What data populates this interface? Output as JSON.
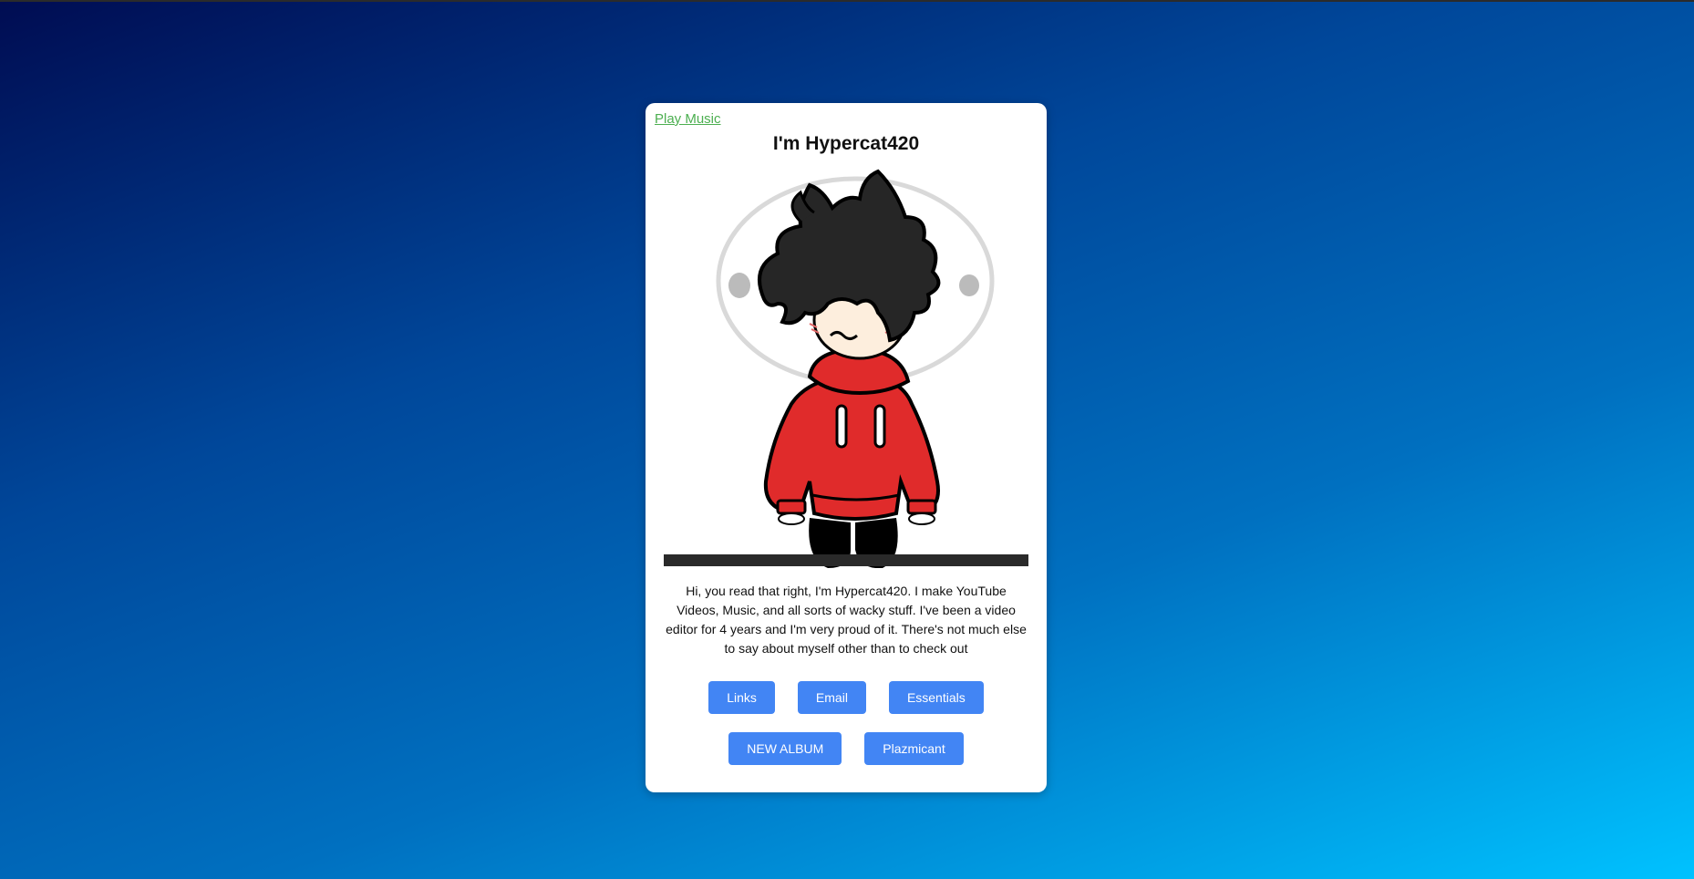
{
  "page": {
    "play_music_link": "Play Music",
    "title": "I'm Hypercat420",
    "avatar_alt": "Hypercat420 avatar",
    "bio": "Hi, you read that right, I'm Hypercat420. I make YouTube Videos, Music, and all sorts of wacky stuff. I've been a video editor for 4 years and I'm very proud of it. There's not much else to say about myself other than to check out"
  },
  "buttons": {
    "row1": [
      "Links",
      "Email",
      "Essentials"
    ],
    "row2": [
      "NEW ALBUM",
      "Plazmicant"
    ]
  },
  "colors": {
    "background_start": "#000c52",
    "background_end": "#00c2ff",
    "button": "#4285f4",
    "link": "#4caf50",
    "hoodie": "#e02b2b"
  }
}
